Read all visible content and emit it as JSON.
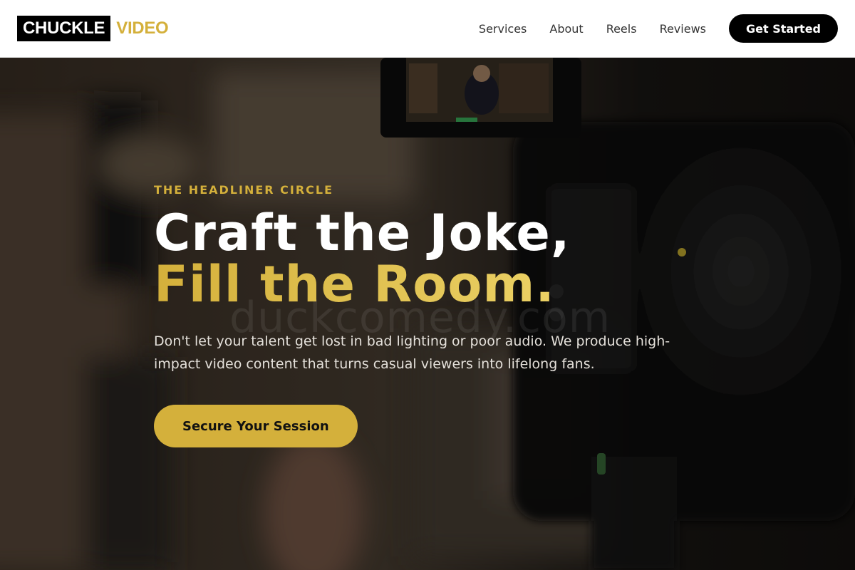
{
  "header": {
    "logo_primary": "CHUCKLE",
    "logo_accent": "VIDEO",
    "nav": [
      {
        "label": "Services"
      },
      {
        "label": "About"
      },
      {
        "label": "Reels"
      },
      {
        "label": "Reviews"
      }
    ],
    "cta_label": "Get Started"
  },
  "hero": {
    "eyebrow": "THE HEADLINER CIRCLE",
    "headline_line1": "Craft the Joke,",
    "headline_line2": "Fill the Room.",
    "description": "Don't let your talent get lost in bad lighting or poor audio. We produce high-impact video content that turns casual viewers into lifelong fans.",
    "cta_label": "Secure Your Session",
    "watermark": "duckcomedy.com",
    "background_image": "blurred-camera-studio-photo"
  },
  "colors": {
    "accent": "#d4b03b",
    "accent_light": "#ecd266",
    "header_bg": "#ffffff",
    "button_dark": "#000000"
  }
}
